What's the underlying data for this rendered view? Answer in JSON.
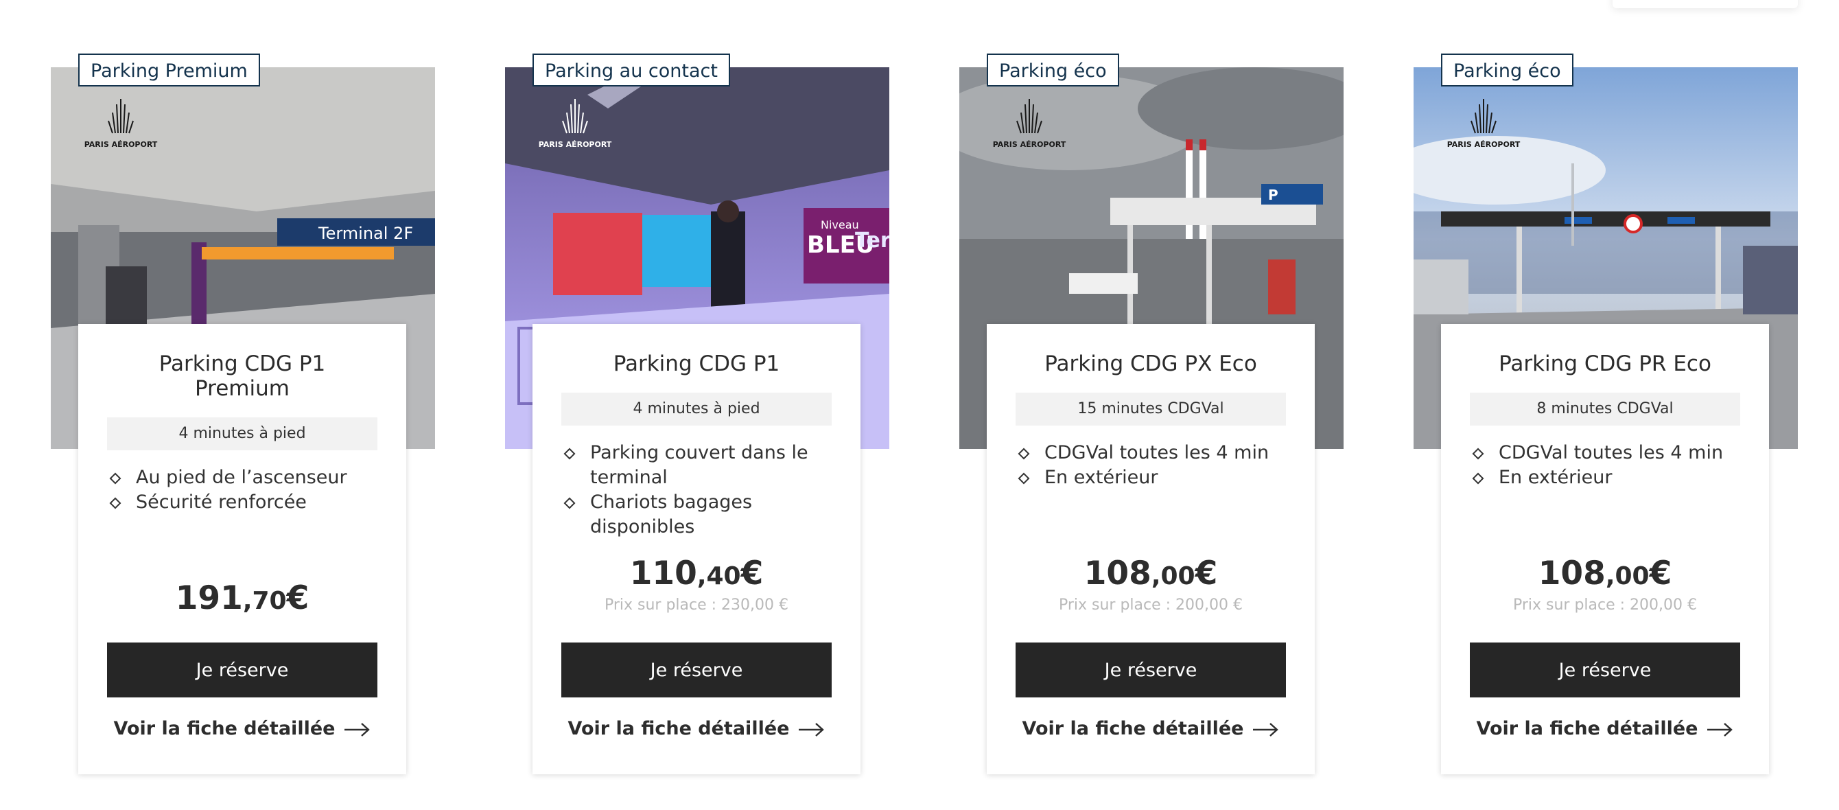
{
  "brand": {
    "logo_text": "PARIS AÉROPORT"
  },
  "colors": {
    "badge_border": "#14334d",
    "button_bg": "#262626",
    "duration_bg": "#f2f2f2"
  },
  "cards": [
    {
      "badge": "Parking Premium",
      "title": "Parking CDG P1 Premium",
      "duration": "4 minutes à pied",
      "features": [
        "Au pied de l’ascenseur",
        "Sécurité renforcée"
      ],
      "price_int": "191",
      "price_cents": ",70",
      "currency": "€",
      "onsite_price": "",
      "cta": "Je réserve",
      "detail_link": "Voir la fiche détaillée"
    },
    {
      "badge": "Parking au contact",
      "title": "Parking CDG P1",
      "duration": "4 minutes à pied",
      "features": [
        "Parking couvert dans le terminal",
        "Chariots bagages disponibles"
      ],
      "price_int": "110",
      "price_cents": ",40",
      "currency": "€",
      "onsite_price": "Prix sur place : 230,00 €",
      "cta": "Je réserve",
      "detail_link": "Voir la fiche détaillée",
      "photo_texts": [
        "Niveau",
        "BLEU",
        "Ter"
      ]
    },
    {
      "badge": "Parking éco",
      "title": "Parking CDG PX Eco",
      "duration": "15 minutes CDGVal",
      "features": [
        "CDGVal toutes les 4 min",
        "En extérieur"
      ],
      "price_int": "108",
      "price_cents": ",00",
      "currency": "€",
      "onsite_price": "Prix sur place : 200,00 €",
      "cta": "Je réserve",
      "detail_link": "Voir la fiche détaillée",
      "photo_texts": [
        "P"
      ]
    },
    {
      "badge": "Parking éco",
      "title": "Parking CDG PR Eco",
      "duration": "8 minutes CDGVal",
      "features": [
        "CDGVal toutes les 4 min",
        "En extérieur"
      ],
      "price_int": "108",
      "price_cents": ",00",
      "currency": "€",
      "onsite_price": "Prix sur place : 200,00 €",
      "cta": "Je réserve",
      "detail_link": "Voir la fiche détaillée"
    }
  ],
  "photo1_sign": "Terminal 2F"
}
